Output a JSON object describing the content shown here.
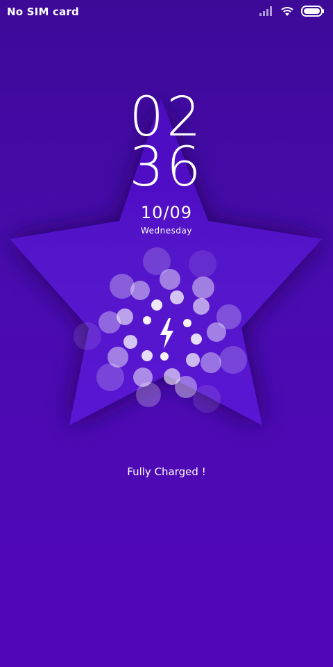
{
  "status_bar": {
    "carrier": "No SIM card",
    "icons": [
      "signal-icon",
      "wifi-icon",
      "battery-icon"
    ]
  },
  "clock": {
    "hours": "02",
    "minutes": "36"
  },
  "date": {
    "day_month": "10/09",
    "weekday": "Wednesday"
  },
  "charging": {
    "status_text": "Fully Charged !",
    "icon": "lightning-bolt-icon",
    "battery_level": 1.0
  },
  "colors": {
    "background": "#4a0bb0",
    "star": "#5a14d0",
    "text": "#ffffff"
  }
}
